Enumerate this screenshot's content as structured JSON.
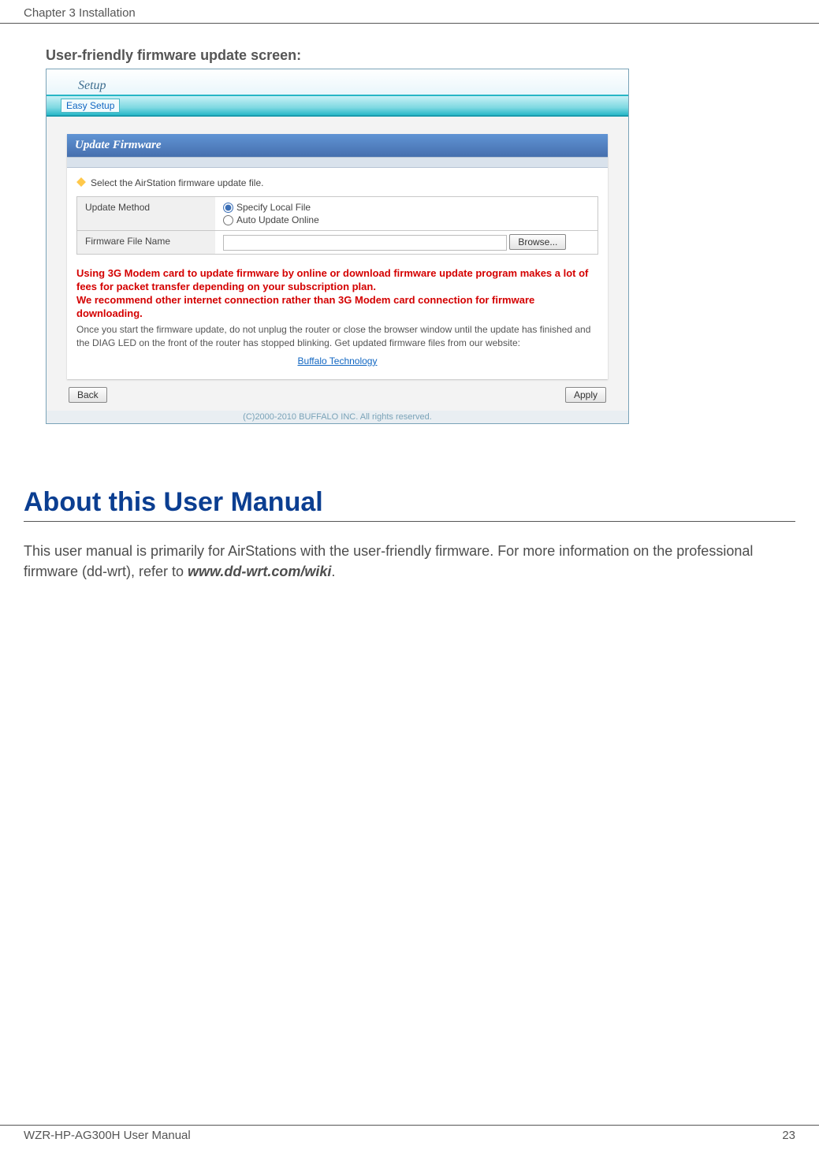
{
  "header": {
    "chapter": "Chapter 3  Installation"
  },
  "caption": "User-friendly firmware update screen:",
  "router": {
    "tab": "Setup",
    "subtab": "Easy Setup",
    "panel_title": "Update Firmware",
    "select_line": "Select the AirStation firmware update file.",
    "rows": {
      "update_method_label": "Update Method",
      "opt_local": "Specify Local File",
      "opt_auto": "Auto Update Online",
      "file_label": "Firmware File Name",
      "browse": "Browse..."
    },
    "warning": "Using 3G Modem card to update firmware by online or download firmware update program makes a lot of fees for packet transfer depending on your subscription plan.\nWe recommend other internet connection rather than 3G Modem card connection for firmware downloading.",
    "note": "Once you start the firmware update, do not unplug the router or close the browser window until the update has finished and the DIAG LED on the front of the router has stopped blinking. Get updated firmware files from our website:",
    "tech_link": "Buffalo Technology",
    "back": "Back",
    "apply": "Apply",
    "copyright": "(C)2000-2010 BUFFALO INC. All rights reserved."
  },
  "section_heading": "About this User Manual",
  "body_prefix": "This user manual is primarily for AirStations with the user-friendly firmware.  For more information on the professional firmware (dd-wrt), refer to ",
  "body_url": "www.dd-wrt.com/wiki",
  "body_suffix": ".",
  "footer": {
    "product": "WZR-HP-AG300H User Manual",
    "page": "23"
  }
}
